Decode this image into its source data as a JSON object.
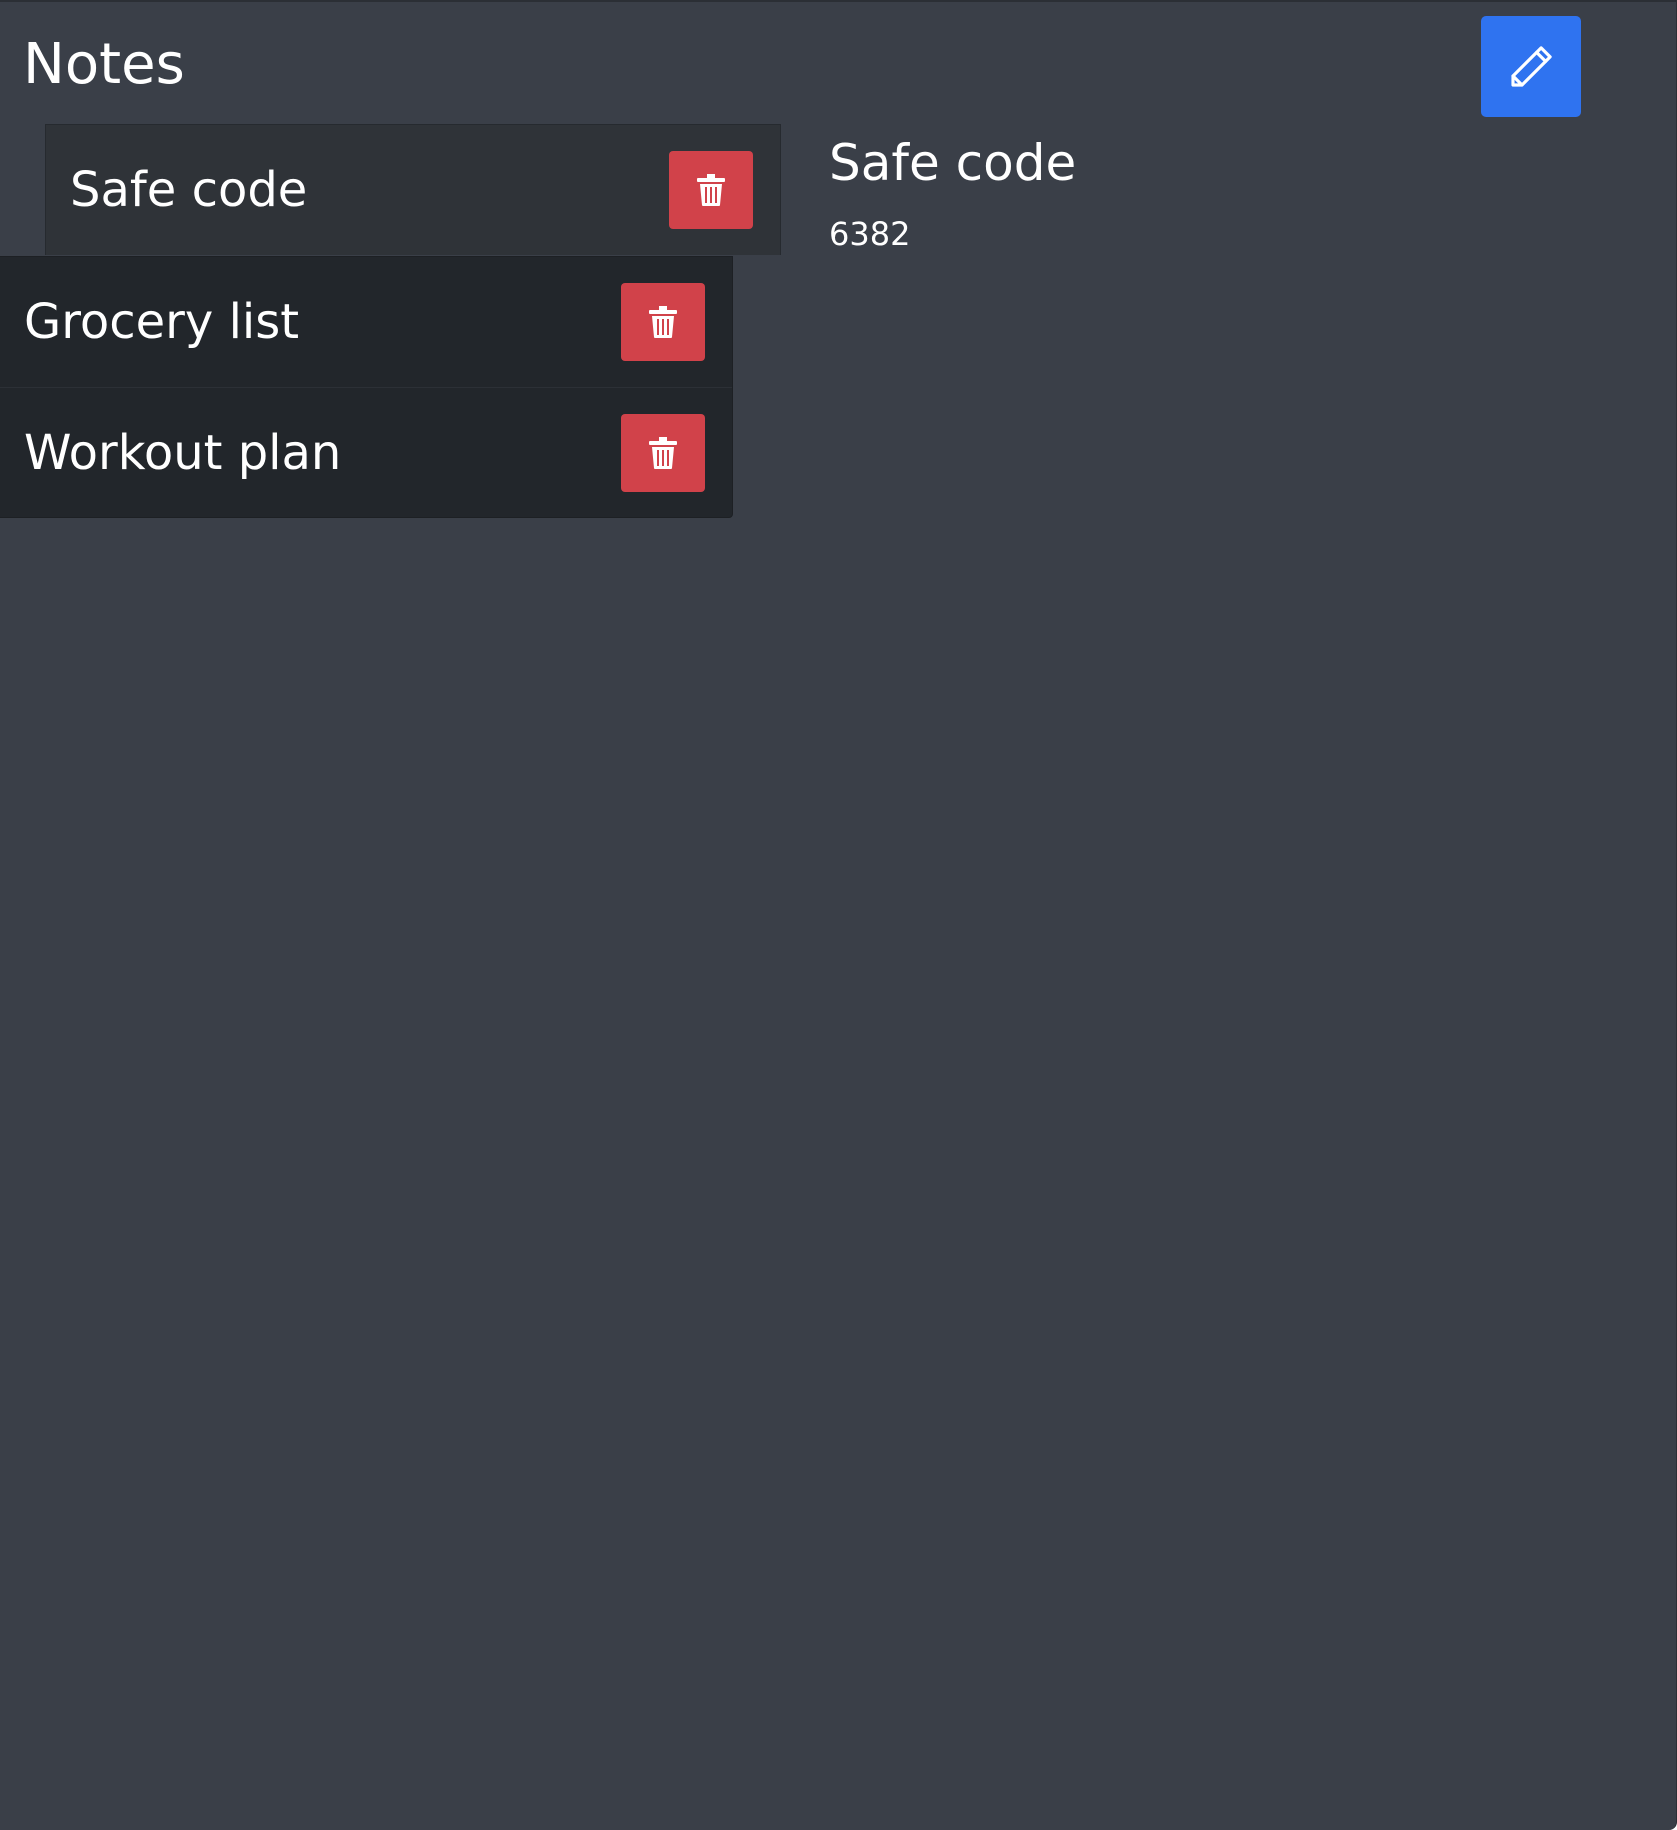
{
  "header": {
    "title": "Notes"
  },
  "toolbar": {
    "edit_icon": "pencil-icon"
  },
  "notes": [
    {
      "label": "Safe code",
      "active": true,
      "delete_icon": "trash-icon"
    },
    {
      "label": "Grocery list",
      "active": false,
      "delete_icon": "trash-icon"
    },
    {
      "label": "Workout plan",
      "active": false,
      "delete_icon": "trash-icon"
    }
  ],
  "detail": {
    "title": "Safe code",
    "body": "6382"
  },
  "colors": {
    "background": "#3a3f48",
    "active_item": "#2f3338",
    "list_items": "#22262b",
    "edit_button": "#2f73f0",
    "delete_button": "#d1424a",
    "text": "#ffffff"
  }
}
